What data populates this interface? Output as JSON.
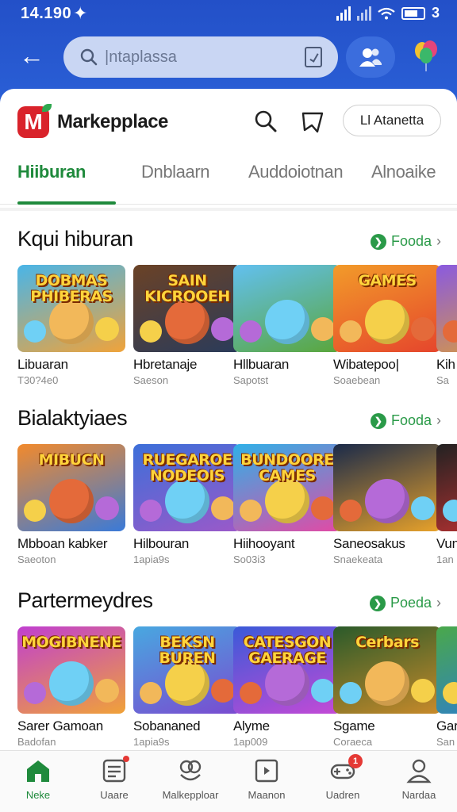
{
  "status": {
    "time": "14.190",
    "battery": "3"
  },
  "search": {
    "placeholder": "|ntaplassa"
  },
  "header": {
    "brand": "Markepplace",
    "action_pill": "Ll Atanetta"
  },
  "tabs": [
    {
      "label": "Hiiburan"
    },
    {
      "label": "Dnblaarn"
    },
    {
      "label": "Auddoiotnan"
    },
    {
      "label": "Alnoaike"
    }
  ],
  "sections": [
    {
      "title": "Kqui hiburan",
      "more": "Fooda",
      "items": [
        {
          "name": "Libuaran",
          "sub": "T30?4e0",
          "art": "DOBMAS PHIBERAS",
          "bg": [
            "#49b5e8",
            "#f0a33a"
          ]
        },
        {
          "name": "Hbretanaje",
          "sub": "Saeson",
          "art": "SAIN KICROOEH",
          "bg": [
            "#6b4226",
            "#2a3b5a"
          ]
        },
        {
          "name": "Hllbuaran",
          "sub": "Sapotst",
          "art": "",
          "bg": [
            "#62c0f0",
            "#5aa63a"
          ]
        },
        {
          "name": "Wibatepoo|",
          "sub": "Soaebean",
          "art": "GAMES",
          "bg": [
            "#f29b2a",
            "#e5452c"
          ]
        },
        {
          "name": "Kih",
          "sub": "Sa",
          "art": "G",
          "bg": [
            "#8a5ae0",
            "#e0a030"
          ]
        }
      ]
    },
    {
      "title": "Bialaktyiaes",
      "more": "Fooda",
      "items": [
        {
          "name": "Mbboan kabker",
          "sub": "Saeoton",
          "art": "MIBUCN",
          "bg": [
            "#f28a2c",
            "#3a7ad8"
          ]
        },
        {
          "name": "Hilbouran",
          "sub": "1apia9s",
          "art": "RUEGAROE NODEOIS",
          "bg": [
            "#3c6fd9",
            "#9b59c9"
          ]
        },
        {
          "name": "Hiihooyant",
          "sub": "So03i3",
          "art": "BUNDOORE CAMES",
          "bg": [
            "#2fb1e8",
            "#e24aa5"
          ]
        },
        {
          "name": "Saneosakus",
          "sub": "Snaekeata",
          "art": "",
          "bg": [
            "#1a2a4a",
            "#e8a22a"
          ]
        },
        {
          "name": "Vun",
          "sub": "1an",
          "art": "",
          "bg": [
            "#222",
            "#c33"
          ]
        }
      ]
    },
    {
      "title": "Partermeydres",
      "more": "Poeda",
      "items": [
        {
          "name": "Sarer Gamoan",
          "sub": "Badofan",
          "art": "MOGIBNENE",
          "bg": [
            "#c03fd0",
            "#f0a238"
          ]
        },
        {
          "name": "Sobananed",
          "sub": "1apia9s",
          "art": "BEKSN BUREN",
          "bg": [
            "#48a8e0",
            "#7a4ad0"
          ]
        },
        {
          "name": "Alyme",
          "sub": "1ap009",
          "art": "CATESGON GAERAGE",
          "bg": [
            "#3a5ad8",
            "#c54ad6"
          ]
        },
        {
          "name": "Sgame",
          "sub": "Coraeca",
          "art": "Cerbars",
          "bg": [
            "#2a5a2a",
            "#c88a2a"
          ]
        },
        {
          "name": "Gar",
          "sub": "San",
          "art": "",
          "bg": [
            "#4aa84a",
            "#2a7ad8"
          ]
        }
      ]
    }
  ],
  "bottom_nav": [
    {
      "label": "Neke",
      "icon": "home-icon"
    },
    {
      "label": "Uaare",
      "icon": "news-icon"
    },
    {
      "label": "Malkepploar",
      "icon": "market-icon"
    },
    {
      "label": "Maanon",
      "icon": "media-icon"
    },
    {
      "label": "Uadren",
      "icon": "gamepad-icon",
      "badge": "1"
    },
    {
      "label": "Nardaa",
      "icon": "profile-icon"
    }
  ]
}
